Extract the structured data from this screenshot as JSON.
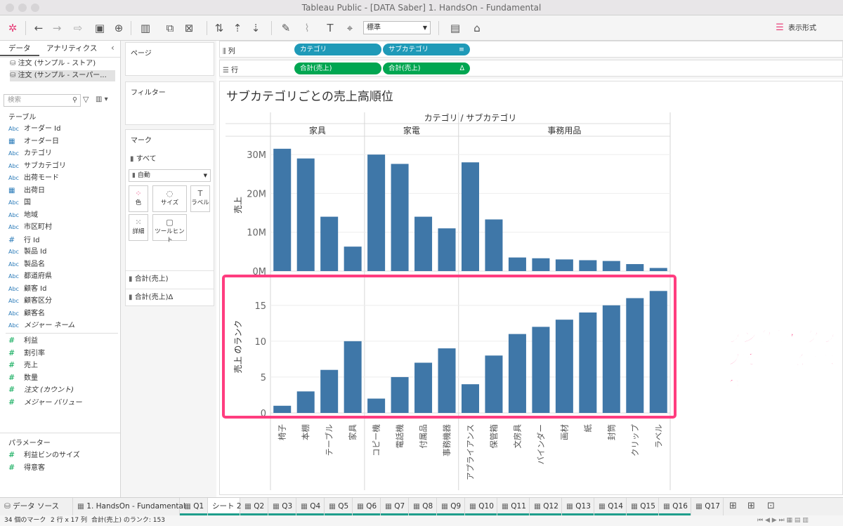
{
  "window": {
    "title": "Tableau Public - [DATA Saber] 1. HandsOn - Fundamental"
  },
  "toolbar": {
    "standard_select": "標準",
    "show_me": "表示形式"
  },
  "data_pane": {
    "tab_data": "データ",
    "tab_analytics": "アナリティクス",
    "sources": [
      "注文 (サンプル - ストア)",
      "注文 (サンプル - スーパー..."
    ],
    "search_placeholder": "検索",
    "tables_header": "テーブル",
    "dimensions": [
      {
        "icon": "Abc",
        "label": "オーダー Id"
      },
      {
        "icon": "date",
        "label": "オーダー日"
      },
      {
        "icon": "Abc",
        "label": "カテゴリ"
      },
      {
        "icon": "Abc",
        "label": "サブカテゴリ"
      },
      {
        "icon": "Abc",
        "label": "出荷モード"
      },
      {
        "icon": "date",
        "label": "出荷日"
      },
      {
        "icon": "Abc",
        "label": "国"
      },
      {
        "icon": "Abc",
        "label": "地域"
      },
      {
        "icon": "Abc",
        "label": "市区町村"
      },
      {
        "icon": "#",
        "label": "行 Id"
      },
      {
        "icon": "Abc",
        "label": "製品 Id"
      },
      {
        "icon": "Abc",
        "label": "製品名"
      },
      {
        "icon": "Abc",
        "label": "都道府県"
      },
      {
        "icon": "Abc",
        "label": "顧客 Id"
      },
      {
        "icon": "Abc",
        "label": "顧客区分"
      },
      {
        "icon": "Abc",
        "label": "顧客名"
      },
      {
        "icon": "Abc",
        "label": "メジャー ネーム"
      }
    ],
    "measures": [
      {
        "label": "利益"
      },
      {
        "label": "割引率"
      },
      {
        "label": "売上"
      },
      {
        "label": "数量"
      },
      {
        "label": "注文 (カウント)"
      },
      {
        "label": "メジャー バリュー"
      }
    ],
    "params_header": "パラメーター",
    "params": [
      {
        "label": "利益ビンのサイズ"
      },
      {
        "label": "得意客"
      }
    ]
  },
  "cards": {
    "pages": "ページ",
    "filters": "フィルター",
    "marks": "マーク",
    "all": "すべて",
    "mark_type": "自動",
    "btn_color": "色",
    "btn_size": "サイズ",
    "btn_label": "ラベル",
    "btn_detail": "詳細",
    "btn_tooltip": "ツールヒント",
    "rows": [
      {
        "label": "合計(売上)"
      },
      {
        "label": "合計(売上)",
        "delta": "Δ"
      }
    ]
  },
  "shelves": {
    "columns_label": "列",
    "rows_label": "行",
    "col_pills": [
      "カテゴリ",
      "サブカテゴリ"
    ],
    "row_pills": [
      "合計(売上)",
      "合計(売上)"
    ],
    "row_delta": "Δ"
  },
  "viz": {
    "title": "サブカテゴリごとの売上高順位",
    "annotation": "ランクが棒グラフで可視化される"
  },
  "chart_data": {
    "type": "bar",
    "header": "カテゴリ / サブカテゴリ",
    "groups": [
      {
        "name": "家具",
        "count": 4
      },
      {
        "name": "家電",
        "count": 4
      },
      {
        "name": "事務用品",
        "count": 9
      }
    ],
    "categories": [
      "椅子",
      "本棚",
      "テーブル",
      "家具",
      "コピー機",
      "電話機",
      "付属品",
      "事務機器",
      "アプライアンス",
      "保管箱",
      "文房具",
      "バインダー",
      "画材",
      "紙",
      "封筒",
      "クリップ",
      "ラベル"
    ],
    "series": [
      {
        "name": "売上",
        "ylabel": "売上",
        "values": [
          31.5,
          29,
          14,
          6.3,
          30,
          27.6,
          14,
          11,
          28,
          13.3,
          3.5,
          3.3,
          3.0,
          2.8,
          2.6,
          1.8,
          0.8
        ],
        "ticks": [
          "0M",
          "10M",
          "20M",
          "30M"
        ],
        "ymax": 34
      },
      {
        "name": "売上 のランク",
        "ylabel": "売上 のランク",
        "values": [
          1,
          3,
          6,
          10,
          2,
          5,
          7,
          9,
          4,
          8,
          11,
          12,
          13,
          14,
          15,
          16,
          17
        ],
        "ticks": [
          "0",
          "5",
          "10",
          "15"
        ],
        "ymax": 18.5
      }
    ]
  },
  "sheet_tabs": [
    "データ ソース",
    "1. HandsOn - Fundamental",
    "Q1",
    "シート 2",
    "Q2",
    "Q3",
    "Q4",
    "Q5",
    "Q6",
    "Q7",
    "Q8",
    "Q9",
    "Q10",
    "Q11",
    "Q12",
    "Q13",
    "Q14",
    "Q15",
    "Q16",
    "Q17"
  ],
  "status": {
    "marks": "34 個のマーク",
    "dims": "2 行 x 17 列",
    "sum": "合計(売上) のランク: 153"
  }
}
